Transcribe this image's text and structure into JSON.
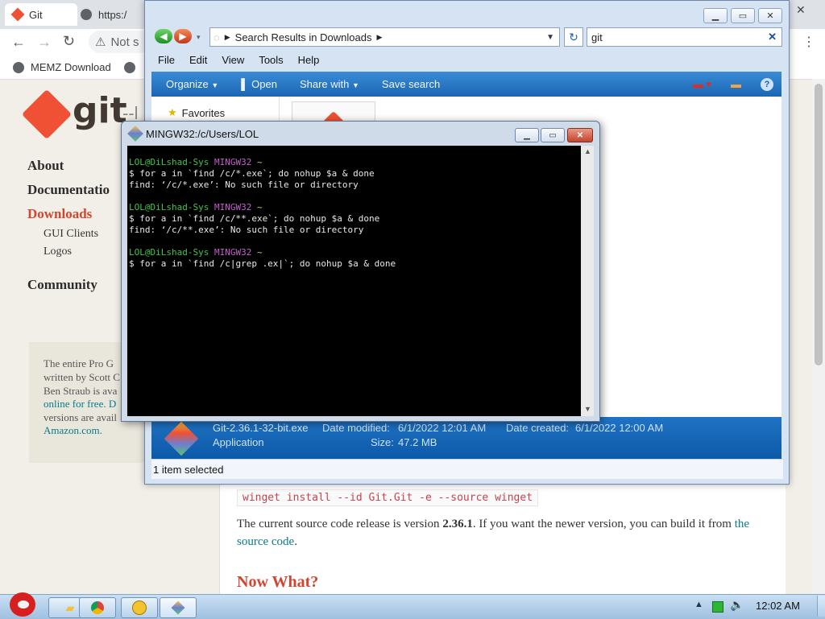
{
  "browser": {
    "tabs": [
      {
        "label": "Git"
      },
      {
        "label": "https:/"
      }
    ],
    "address_partial": "Not s",
    "bookmarks": [
      {
        "label": "MEMZ Download"
      }
    ]
  },
  "site": {
    "logo_text": "git",
    "logo_tail": "--l",
    "nav": [
      {
        "label": "About"
      },
      {
        "label": "Documentatio"
      },
      {
        "label": "Downloads"
      },
      {
        "label": "Community"
      }
    ],
    "sub_nav": [
      {
        "label": "GUI Clients"
      },
      {
        "label": "Logos"
      }
    ],
    "promo_lines": [
      "The entire Pro G",
      "written by Scott C",
      "Ben Straub is ava",
      "online for free. D",
      "versions are avail",
      "Amazon.com."
    ],
    "winget_cmd": "winget install --id Git.Git -e --source winget",
    "release_prefix": "The current source code release is version ",
    "release_version": "2.36.1",
    "release_mid": ". If you want the newer version, you can build it from ",
    "release_link1": "the",
    "release_link2": "source code",
    "release_end": ".",
    "now_what": "Now What?"
  },
  "explorer": {
    "address_text": "Search Results in Downloads",
    "search_value": "git",
    "menu": [
      "File",
      "Edit",
      "View",
      "Tools",
      "Help"
    ],
    "commands": [
      "Organize",
      "Open",
      "Share with",
      "Save search"
    ],
    "nav_favorites": "Favorites",
    "file": {
      "name": "Git-2.36.1-32-bit.exe",
      "type": "Application",
      "date_modified_label": "Date modified:",
      "date_modified": "6/1/2022 12:01 AM",
      "date_created_label": "Date created:",
      "date_created": "6/1/2022 12:00 AM",
      "size_label": "Size:",
      "size": "47.2 MB"
    },
    "status": "1 item selected"
  },
  "terminal": {
    "title": "MINGW32:/c/Users/LOL",
    "blocks": [
      {
        "user": "LOL@DiLshad-Sys",
        "host": "MINGW32",
        "dir": "~",
        "cmd": "$ for a in `find /c/*.exe`; do nohup $a & done",
        "out": "find: ‘/c/*.exe’: No such file or directory"
      },
      {
        "user": "LOL@DiLshad-Sys",
        "host": "MINGW32",
        "dir": "~",
        "cmd": "$ for a in `find /c/**.exe`; do nohup $a & done",
        "out": "find: ‘/c/**.exe’: No such file or directory"
      },
      {
        "user": "LOL@DiLshad-Sys",
        "host": "MINGW32",
        "dir": "~",
        "cmd": "$ for a in `find /c|grep .ex|`; do nohup $a & done",
        "out": ""
      }
    ]
  },
  "taskbar": {
    "clock": "12:02 AM"
  },
  "colors": {
    "git_orange": "#f05033",
    "explorer_blue": "#1a66b3",
    "terminal_bg": "#000000"
  }
}
